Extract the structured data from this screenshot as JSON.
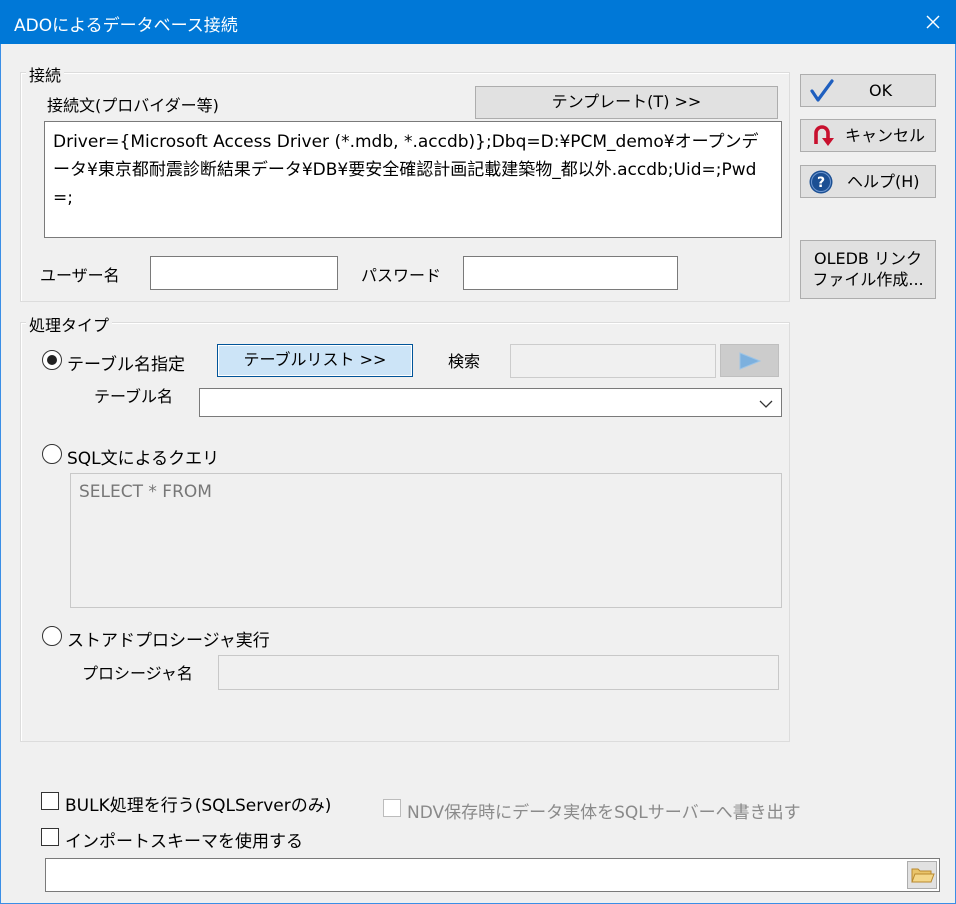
{
  "window": {
    "title": "ADOによるデータベース接続"
  },
  "connection": {
    "group_label": "接続",
    "conn_label": "接続文(プロバイダー等)",
    "template_button": "テンプレート(T) >>",
    "conn_string": "Driver={Microsoft Access Driver (*.mdb, *.accdb)};Dbq=D:¥PCM_demo¥オープンデータ¥東京都耐震診断結果データ¥DB¥要安全確認計画記載建築物_都以外.accdb;Uid=;Pwd=;",
    "username_label": "ユーザー名",
    "username_value": "",
    "password_label": "パスワード",
    "password_value": ""
  },
  "side_buttons": {
    "ok": "OK",
    "cancel": "キャンセル",
    "help": "ヘルプ(H)",
    "oledb_line1": "OLEDB リンク",
    "oledb_line2": "ファイル作成..."
  },
  "process": {
    "group_label": "処理タイプ",
    "table_radio": "テーブル名指定",
    "table_list_button": "テーブルリスト >>",
    "search_label": "検索",
    "search_value": "",
    "table_name_label": "テーブル名",
    "table_name_value": "",
    "sql_radio": "SQL文によるクエリ",
    "sql_text": "SELECT * FROM",
    "sp_radio": "ストアドプロシージャ実行",
    "sp_name_label": "プロシージャ名",
    "sp_name_value": "",
    "selected": "table"
  },
  "options": {
    "bulk_label": "BULK処理を行う(SQLServerのみ)",
    "bulk_checked": false,
    "ndv_label": "NDV保存時にデータ実体をSQLサーバーへ書き出す",
    "ndv_checked": false,
    "import_label": "インポートスキーマを使用する",
    "import_checked": false,
    "schema_path": ""
  },
  "colors": {
    "titlebar": "#0078d7",
    "accent_check": "#1f5fbf",
    "cancel_icon": "#c8102e",
    "help_icon": "#1b4f93"
  }
}
